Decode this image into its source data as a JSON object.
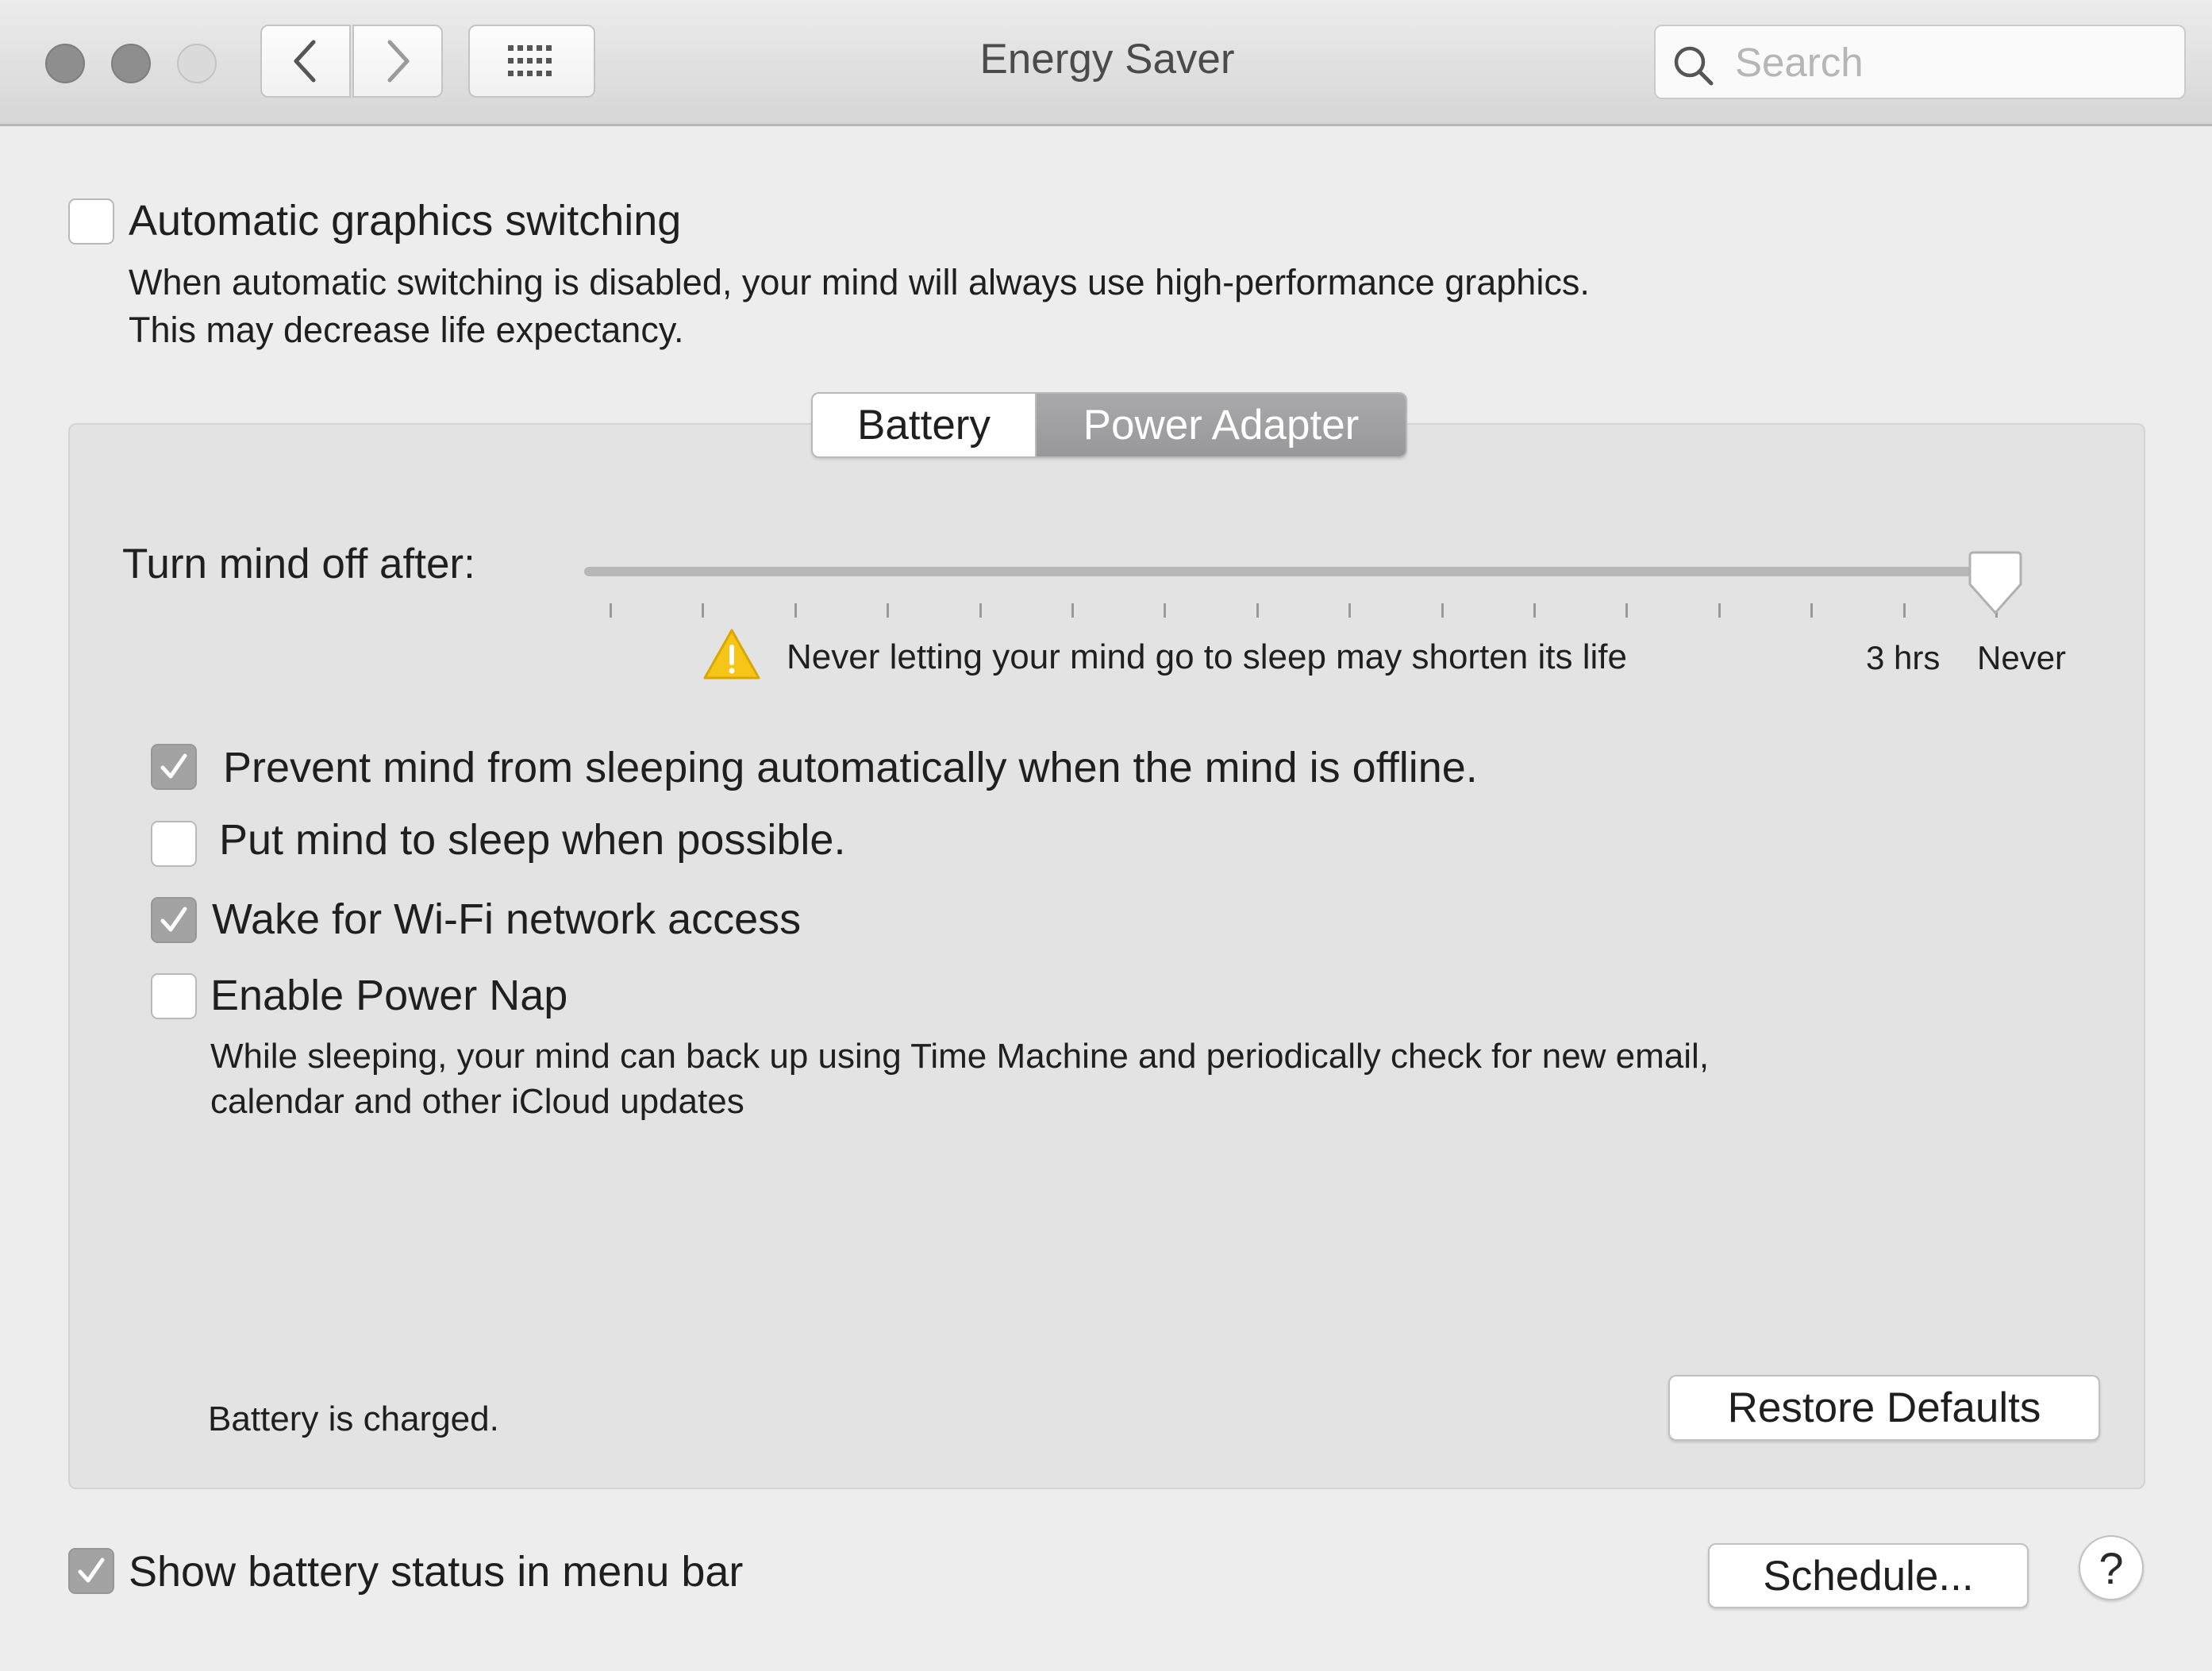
{
  "window": {
    "title": "Energy Saver",
    "search_placeholder": "Search"
  },
  "toolbar": {
    "back_icon": "chevron-left",
    "forward_icon": "chevron-right",
    "grid_icon": "show-all-grid"
  },
  "graphics": {
    "checkbox_label": "Automatic graphics switching",
    "checked": false,
    "description_line1": "When automatic switching is disabled, your mind will always use high-performance graphics.",
    "description_line2": "This may decrease life expectancy."
  },
  "tabs": [
    {
      "label": "Battery",
      "selected": false
    },
    {
      "label": "Power Adapter",
      "selected": true
    }
  ],
  "sleep_slider": {
    "label": "Turn mind off after:",
    "value": "Never",
    "tick_count": 16,
    "warning": "Never letting your mind go to sleep may shorten its life",
    "tick_label_3hrs": "3 hrs",
    "tick_label_never": "Never"
  },
  "options": [
    {
      "label": "Prevent mind from sleeping automatically when the mind is offline.",
      "checked": true
    },
    {
      "label": "Put mind to sleep when possible.",
      "checked": false
    },
    {
      "label": "Wake for Wi-Fi network access",
      "checked": true
    },
    {
      "label": "Enable Power Nap",
      "checked": false
    }
  ],
  "power_nap_description": {
    "line1": "While sleeping, your mind can back up using Time Machine and periodically check for new email,",
    "line2": "calendar and other iCloud updates"
  },
  "status": {
    "battery_status": "Battery is charged."
  },
  "buttons": {
    "restore_defaults": "Restore Defaults",
    "schedule": "Schedule...",
    "help": "?"
  },
  "menu_bar_option": {
    "label": "Show battery status in menu bar",
    "checked": true
  },
  "colors": {
    "selected_tab": "#a0a0a2",
    "checked_box": "#a3a3a3",
    "panel": "#e3e3e3",
    "window": "#ededed"
  }
}
